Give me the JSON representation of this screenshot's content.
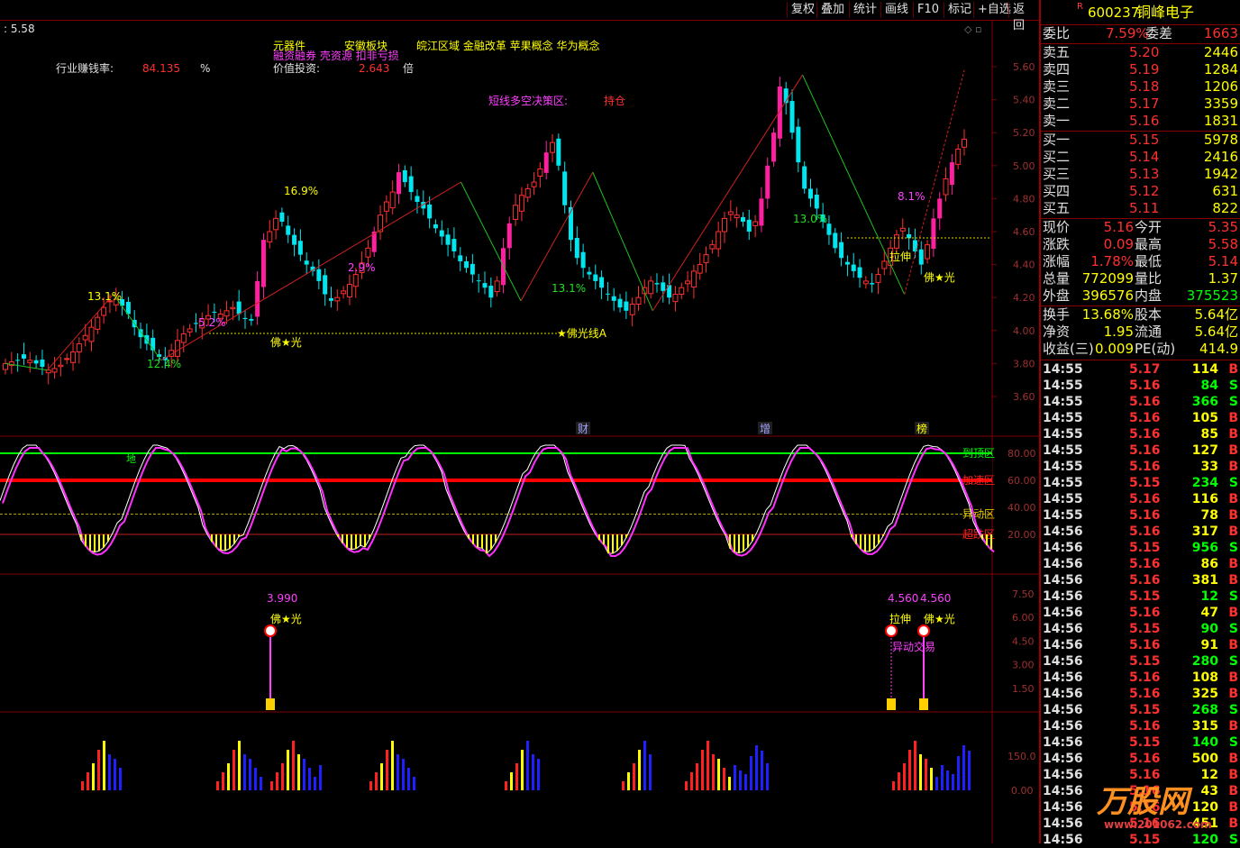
{
  "toolbar": {
    "buttons": [
      "复权",
      "叠加",
      "统计",
      "画线",
      "F10",
      "标记",
      "+自选",
      "返回"
    ]
  },
  "chart": {
    "cursor_value": ": 5.58",
    "industry_label": "行业赚钱率:",
    "industry_value": "84.135",
    "industry_unit": "%",
    "value_invest_label": "价值投资:",
    "value_invest_value": "2.643",
    "value_invest_unit": "倍",
    "concept_tags": {
      "tag1": "元器件",
      "tag2": "安徽板块",
      "tag3": "皖江区域 金融改革 苹果概念 华为概念",
      "tag4": "融资融券 壳资源 扣非亏损"
    },
    "decision_label": "短线多空决策区:",
    "decision_value": "持仓",
    "line_label": "★佛光线A",
    "buddha_label": "佛★光",
    "pull_label": "拉伸",
    "pct_labels": [
      "13.1%",
      "16.9%",
      "12.4%",
      "5.2%",
      "2.9%",
      "13.1%",
      "13.0%",
      "8.1%"
    ],
    "event_markers": [
      "财",
      "增",
      "榜"
    ],
    "price_ticks": [
      "5.60",
      "5.40",
      "5.20",
      "5.00",
      "4.80",
      "4.60",
      "4.40",
      "4.20",
      "4.00",
      "3.80",
      "3.60"
    ],
    "osc_ticks": [
      "80.00",
      "60.00",
      "40.00",
      "20.00"
    ],
    "osc_zone_labels": [
      "到顶区",
      "加速区",
      "异动区",
      "超跌区"
    ],
    "osc_top_marker": "地",
    "signal_ticks": [
      "7.50",
      "6.00",
      "4.50",
      "3.00",
      "1.50"
    ],
    "signal_values": [
      "3.990",
      "4.560",
      "4.560"
    ],
    "signal_labels": [
      "佛★光",
      "拉伸",
      "佛★光",
      "异动交易"
    ],
    "vol_ticks": [
      "150.0",
      "0.00"
    ],
    "colors": {
      "up": "#ff3030",
      "down": "#00e5ee",
      "limit": "#ff20a0",
      "zone_top": "#00ff00",
      "zone_acc": "#ff0000"
    }
  },
  "quote": {
    "flag": "R",
    "code": "600237",
    "name": "铜峰电子",
    "weibi_label": "委比",
    "weibi_value": "7.59%",
    "weicha_label": "委差",
    "weicha_value": "1663",
    "asks": [
      {
        "label": "卖五",
        "price": "5.20",
        "vol": "2446"
      },
      {
        "label": "卖四",
        "price": "5.19",
        "vol": "1284"
      },
      {
        "label": "卖三",
        "price": "5.18",
        "vol": "1206"
      },
      {
        "label": "卖二",
        "price": "5.17",
        "vol": "3359"
      },
      {
        "label": "卖一",
        "price": "5.16",
        "vol": "1831"
      }
    ],
    "bids": [
      {
        "label": "买一",
        "price": "5.15",
        "vol": "5978"
      },
      {
        "label": "买二",
        "price": "5.14",
        "vol": "2416"
      },
      {
        "label": "买三",
        "price": "5.13",
        "vol": "1942"
      },
      {
        "label": "买四",
        "price": "5.12",
        "vol": "631"
      },
      {
        "label": "买五",
        "price": "5.11",
        "vol": "822"
      }
    ],
    "stats": [
      {
        "l1": "现价",
        "v1": "5.16",
        "l2": "今开",
        "v2": "5.35"
      },
      {
        "l1": "涨跌",
        "v1": "0.09",
        "l2": "最高",
        "v2": "5.58"
      },
      {
        "l1": "涨幅",
        "v1": "1.78%",
        "l2": "最低",
        "v2": "5.14"
      },
      {
        "l1": "总量",
        "v1": "772099",
        "l2": "量比",
        "v2": "1.37"
      },
      {
        "l1": "外盘",
        "v1": "396576",
        "l2": "内盘",
        "v2": "375523"
      }
    ],
    "stats2": [
      {
        "l1": "换手",
        "v1": "13.68%",
        "l2": "股本",
        "v2": "5.64亿"
      },
      {
        "l1": "净资",
        "v1": "1.95",
        "l2": "流通",
        "v2": "5.64亿"
      },
      {
        "l1": "收益(三)",
        "v1": "0.009",
        "l2": "PE(动)",
        "v2": "414.9"
      }
    ],
    "ticks": [
      [
        "14:55",
        "5.17",
        "114",
        "B"
      ],
      [
        "14:55",
        "5.16",
        "84",
        "S"
      ],
      [
        "14:55",
        "5.16",
        "366",
        "S"
      ],
      [
        "14:55",
        "5.16",
        "105",
        "B"
      ],
      [
        "14:55",
        "5.16",
        "85",
        "B"
      ],
      [
        "14:55",
        "5.16",
        "127",
        "B"
      ],
      [
        "14:55",
        "5.16",
        "33",
        "B"
      ],
      [
        "14:55",
        "5.15",
        "234",
        "S"
      ],
      [
        "14:55",
        "5.16",
        "116",
        "B"
      ],
      [
        "14:55",
        "5.16",
        "78",
        "B"
      ],
      [
        "14:56",
        "5.16",
        "317",
        "B"
      ],
      [
        "14:56",
        "5.15",
        "956",
        "S"
      ],
      [
        "14:56",
        "5.16",
        "86",
        "B"
      ],
      [
        "14:56",
        "5.16",
        "381",
        "B"
      ],
      [
        "14:56",
        "5.15",
        "12",
        "S"
      ],
      [
        "14:56",
        "5.16",
        "47",
        "B"
      ],
      [
        "14:56",
        "5.15",
        "90",
        "S"
      ],
      [
        "14:56",
        "5.16",
        "91",
        "B"
      ],
      [
        "14:56",
        "5.15",
        "280",
        "S"
      ],
      [
        "14:56",
        "5.16",
        "108",
        "B"
      ],
      [
        "14:56",
        "5.16",
        "325",
        "B"
      ],
      [
        "14:56",
        "5.15",
        "268",
        "S"
      ],
      [
        "14:56",
        "5.16",
        "315",
        "B"
      ],
      [
        "14:56",
        "5.15",
        "140",
        "S"
      ],
      [
        "14:56",
        "5.16",
        "500",
        "B"
      ],
      [
        "14:56",
        "5.16",
        "12",
        "B"
      ],
      [
        "14:56",
        "5.16",
        "43",
        "B"
      ],
      [
        "14:56",
        "5.16",
        "120",
        "B"
      ],
      [
        "14:56",
        "5.16",
        "451",
        "B"
      ],
      [
        "14:56",
        "5.15",
        "120",
        "S"
      ]
    ],
    "watermark": "万股网",
    "watermark_url": "www.201062.com"
  }
}
